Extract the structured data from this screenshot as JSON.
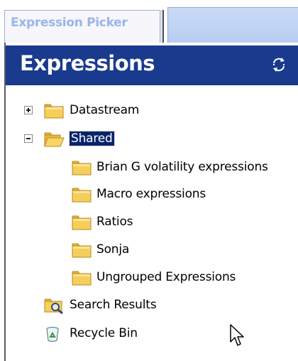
{
  "tab": {
    "label": "Expression Picker"
  },
  "panel": {
    "title": "Expressions",
    "refresh_icon": "refresh-icon"
  },
  "tree": {
    "datastream": {
      "label": "Datastream",
      "icon": "folder-closed-icon",
      "expanded": false
    },
    "shared": {
      "label": "Shared",
      "icon": "folder-open-icon",
      "expanded": true,
      "selected": true,
      "children": [
        {
          "label": "Brian G volatility expressions",
          "icon": "folder-closed-icon"
        },
        {
          "label": "Macro expressions",
          "icon": "folder-closed-icon"
        },
        {
          "label": "Ratios",
          "icon": "folder-closed-icon"
        },
        {
          "label": "Sonja",
          "icon": "folder-closed-icon"
        },
        {
          "label": "Ungrouped Expressions",
          "icon": "folder-closed-icon"
        }
      ]
    },
    "search_results": {
      "label": "Search Results",
      "icon": "search-folder-icon"
    },
    "recycle_bin": {
      "label": "Recycle Bin",
      "icon": "recycle-bin-icon"
    }
  },
  "colors": {
    "header_bg": "#1a3a8e",
    "selection_bg": "#0a246a",
    "folder_yellow": "#f5cf5a",
    "tab_text": "#9ab5e8"
  }
}
